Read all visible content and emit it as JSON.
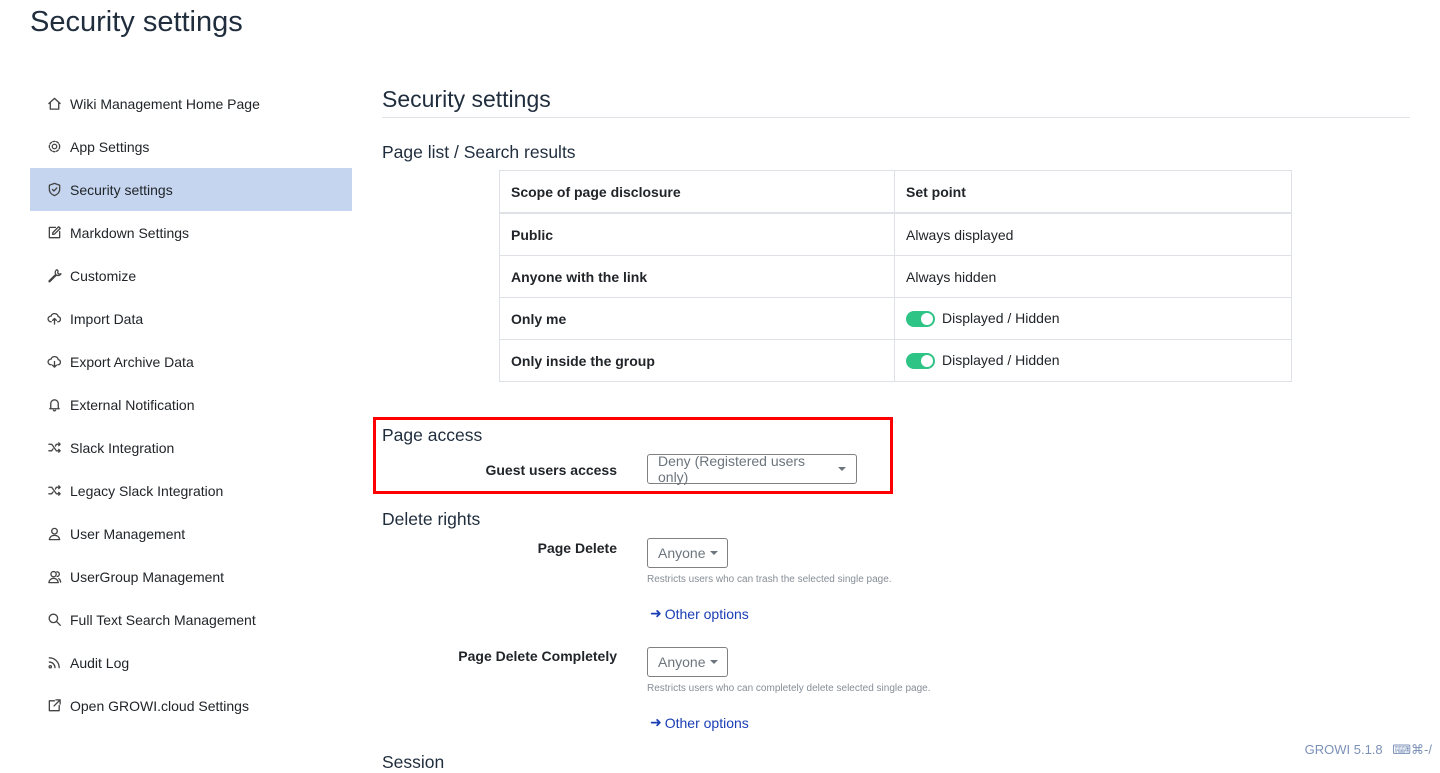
{
  "page_title": "Security settings",
  "sidebar": {
    "items": [
      {
        "label": "Wiki Management Home Page",
        "icon": "home-icon"
      },
      {
        "label": "App Settings",
        "icon": "gear-icon"
      },
      {
        "label": "Security settings",
        "icon": "shield-icon",
        "active": true
      },
      {
        "label": "Markdown Settings",
        "icon": "edit-icon"
      },
      {
        "label": "Customize",
        "icon": "wrench-icon"
      },
      {
        "label": "Import Data",
        "icon": "cloud-upload-icon"
      },
      {
        "label": "Export Archive Data",
        "icon": "cloud-download-icon"
      },
      {
        "label": "External Notification",
        "icon": "bell-icon"
      },
      {
        "label": "Slack Integration",
        "icon": "shuffle-icon"
      },
      {
        "label": "Legacy Slack Integration",
        "icon": "shuffle-icon"
      },
      {
        "label": "User Management",
        "icon": "user-icon"
      },
      {
        "label": "UserGroup Management",
        "icon": "users-icon"
      },
      {
        "label": "Full Text Search Management",
        "icon": "search-icon"
      },
      {
        "label": "Audit Log",
        "icon": "rss-icon"
      },
      {
        "label": "Open GROWI.cloud Settings",
        "icon": "external-link-icon"
      }
    ]
  },
  "main": {
    "heading": "Security settings",
    "page_list_heading": "Page list / Search results",
    "scope_table": {
      "headers": [
        "Scope of page disclosure",
        "Set point"
      ],
      "rows": [
        {
          "scope": "Public",
          "value": "Always displayed",
          "toggle": false
        },
        {
          "scope": "Anyone with the link",
          "value": "Always hidden",
          "toggle": false
        },
        {
          "scope": "Only me",
          "value": "Displayed / Hidden",
          "toggle": true
        },
        {
          "scope": "Only inside the group",
          "value": "Displayed / Hidden",
          "toggle": true
        }
      ]
    },
    "page_access": {
      "heading": "Page access",
      "guest_label": "Guest users access",
      "guest_value": "Deny (Registered users only)"
    },
    "delete_rights": {
      "heading": "Delete rights",
      "page_delete_label": "Page Delete",
      "page_delete_value": "Anyone",
      "page_delete_help": "Restricts users who can trash the selected single page.",
      "page_delete_completely_label": "Page Delete Completely",
      "page_delete_completely_value": "Anyone",
      "page_delete_completely_help": "Restricts users who can completely delete selected single page.",
      "other_options": "Other options"
    },
    "next_heading_partial": "Session"
  },
  "footer": {
    "version": "GROWI 5.1.8",
    "shortcut": "⌘-/"
  },
  "colors": {
    "active_bg": "#c5d5ef",
    "toggle_on": "#2ec486",
    "link": "#1a3eb4",
    "highlight": "#ff0000"
  }
}
